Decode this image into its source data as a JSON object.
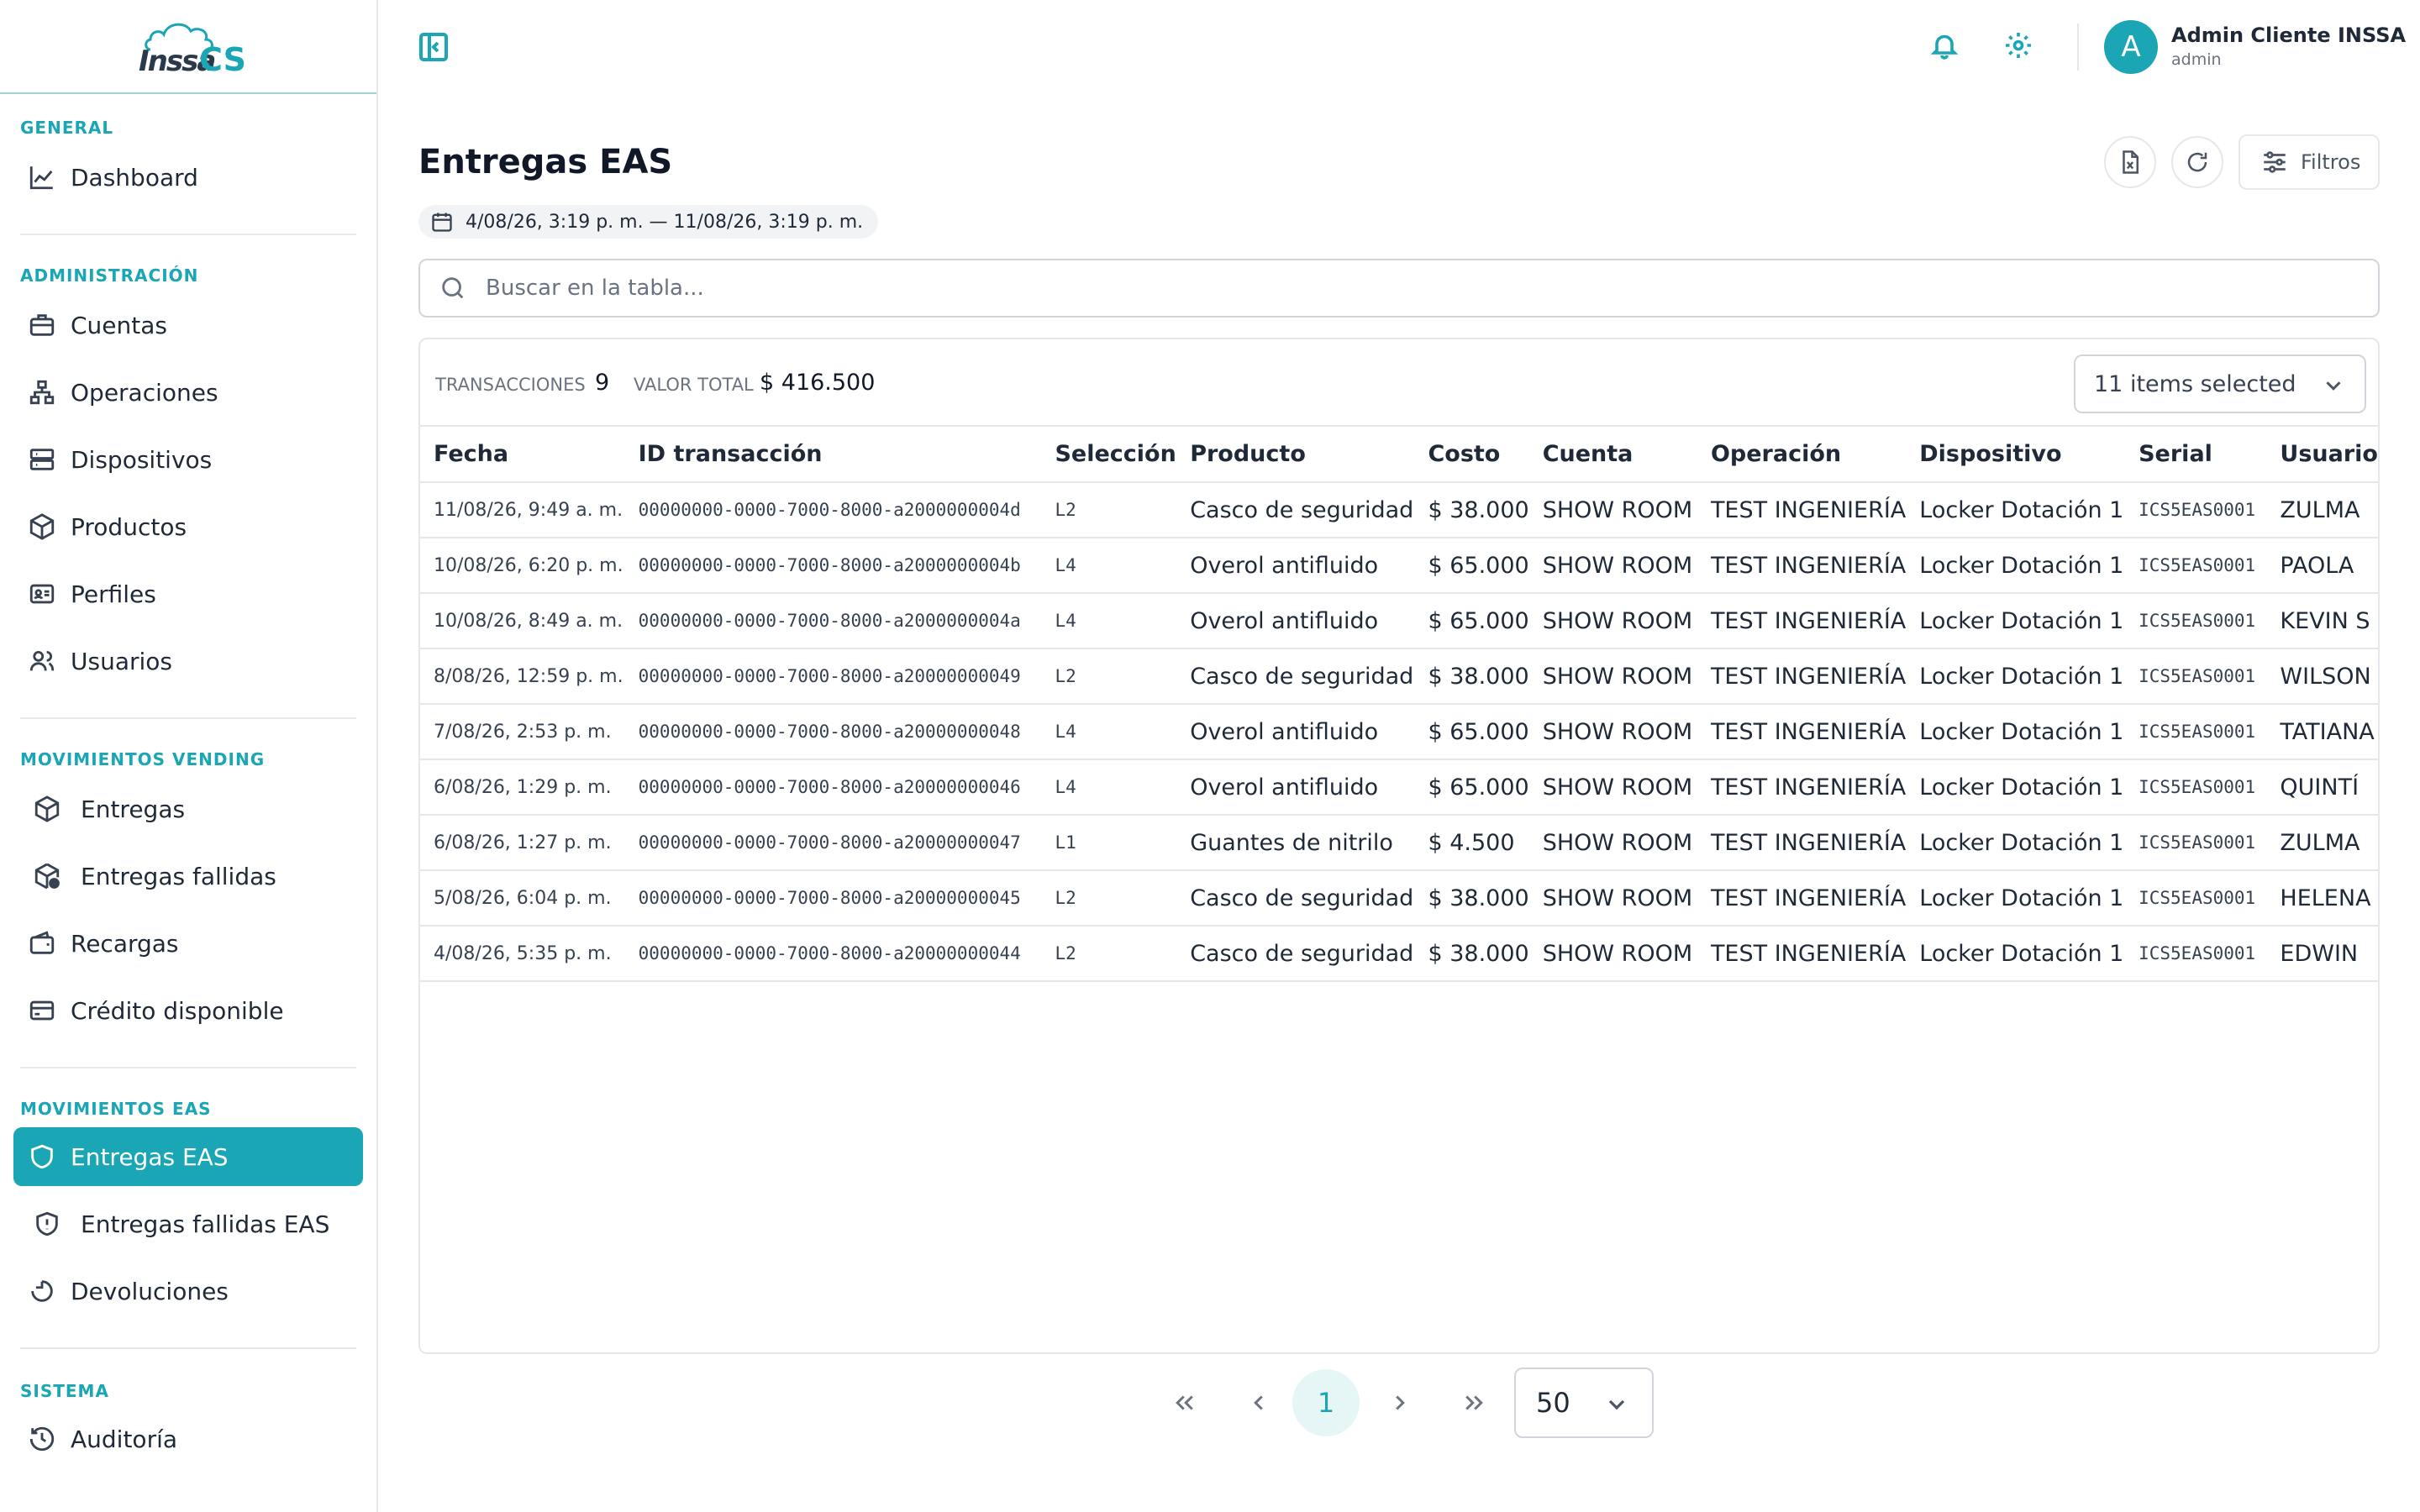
{
  "app": {
    "logo_text": "Inssa",
    "logo_suffix": "CS"
  },
  "sidebar": {
    "sections": {
      "general": "GENERAL",
      "administracion": "ADMINISTRACIÓN",
      "vending": "MOVIMIENTOS VENDING",
      "eas": "MOVIMIENTOS EAS",
      "sistema": "SISTEMA"
    },
    "items": {
      "dashboard": "Dashboard",
      "cuentas": "Cuentas",
      "operaciones": "Operaciones",
      "dispositivos": "Dispositivos",
      "productos": "Productos",
      "perfiles": "Perfiles",
      "usuarios": "Usuarios",
      "entregas": "Entregas",
      "entregas_fallidas": "Entregas fallidas",
      "recargas": "Recargas",
      "credito": "Crédito disponible",
      "entregas_eas": "Entregas EAS",
      "entregas_fallidas_eas": "Entregas fallidas EAS",
      "devoluciones": "Devoluciones",
      "auditoria": "Auditoría"
    },
    "active": "entregas_eas"
  },
  "header": {
    "user_initial": "A",
    "user_name": "Admin Cliente INSSA",
    "user_role": "admin"
  },
  "page": {
    "title": "Entregas EAS",
    "date_range": "4/08/26, 3:19 p. m. — 11/08/26, 3:19 p. m.",
    "filters_label": "Filtros",
    "search_placeholder": "Buscar en la tabla..."
  },
  "summary": {
    "transactions_label": "TRANSACCIONES",
    "transactions_value": "9",
    "total_label": "VALOR TOTAL",
    "total_value": "$ 416.500",
    "columns_selected": "11 items selected"
  },
  "table": {
    "columns": [
      "Fecha",
      "ID transacción",
      "Selección",
      "Producto",
      "Costo",
      "Cuenta",
      "Operación",
      "Dispositivo",
      "Serial",
      "Usuario"
    ],
    "rows": [
      [
        "11/08/26, 9:49 a. m.",
        "00000000-0000-7000-8000-a2000000004d",
        "L2",
        "Casco de seguridad",
        "$ 38.000",
        "SHOW ROOM",
        "TEST INGENIERÍA",
        "Locker Dotación 1",
        "ICS5EAS0001",
        "ZULMA"
      ],
      [
        "10/08/26, 6:20 p. m.",
        "00000000-0000-7000-8000-a2000000004b",
        "L4",
        "Overol antifluido",
        "$ 65.000",
        "SHOW ROOM",
        "TEST INGENIERÍA",
        "Locker Dotación 1",
        "ICS5EAS0001",
        "PAOLA"
      ],
      [
        "10/08/26, 8:49 a. m.",
        "00000000-0000-7000-8000-a2000000004a",
        "L4",
        "Overol antifluido",
        "$ 65.000",
        "SHOW ROOM",
        "TEST INGENIERÍA",
        "Locker Dotación 1",
        "ICS5EAS0001",
        "KEVIN S"
      ],
      [
        "8/08/26, 12:59 p. m.",
        "00000000-0000-7000-8000-a20000000049",
        "L2",
        "Casco de seguridad",
        "$ 38.000",
        "SHOW ROOM",
        "TEST INGENIERÍA",
        "Locker Dotación 1",
        "ICS5EAS0001",
        "WILSON"
      ],
      [
        "7/08/26, 2:53 p. m.",
        "00000000-0000-7000-8000-a20000000048",
        "L4",
        "Overol antifluido",
        "$ 65.000",
        "SHOW ROOM",
        "TEST INGENIERÍA",
        "Locker Dotación 1",
        "ICS5EAS0001",
        "TATIANA"
      ],
      [
        "6/08/26, 1:29 p. m.",
        "00000000-0000-7000-8000-a20000000046",
        "L4",
        "Overol antifluido",
        "$ 65.000",
        "SHOW ROOM",
        "TEST INGENIERÍA",
        "Locker Dotación 1",
        "ICS5EAS0001",
        "QUINTÍ"
      ],
      [
        "6/08/26, 1:27 p. m.",
        "00000000-0000-7000-8000-a20000000047",
        "L1",
        "Guantes de nitrilo",
        "$ 4.500",
        "SHOW ROOM",
        "TEST INGENIERÍA",
        "Locker Dotación 1",
        "ICS5EAS0001",
        "ZULMA"
      ],
      [
        "5/08/26, 6:04 p. m.",
        "00000000-0000-7000-8000-a20000000045",
        "L2",
        "Casco de seguridad",
        "$ 38.000",
        "SHOW ROOM",
        "TEST INGENIERÍA",
        "Locker Dotación 1",
        "ICS5EAS0001",
        "HELENA"
      ],
      [
        "4/08/26, 5:35 p. m.",
        "00000000-0000-7000-8000-a20000000044",
        "L2",
        "Casco de seguridad",
        "$ 38.000",
        "SHOW ROOM",
        "TEST INGENIERÍA",
        "Locker Dotación 1",
        "ICS5EAS0001",
        "EDWIN"
      ]
    ]
  },
  "pagination": {
    "current_page": "1",
    "page_size": "50"
  },
  "colors": {
    "accent": "#1aa6b4",
    "accent_light": "#e6f6f7"
  }
}
